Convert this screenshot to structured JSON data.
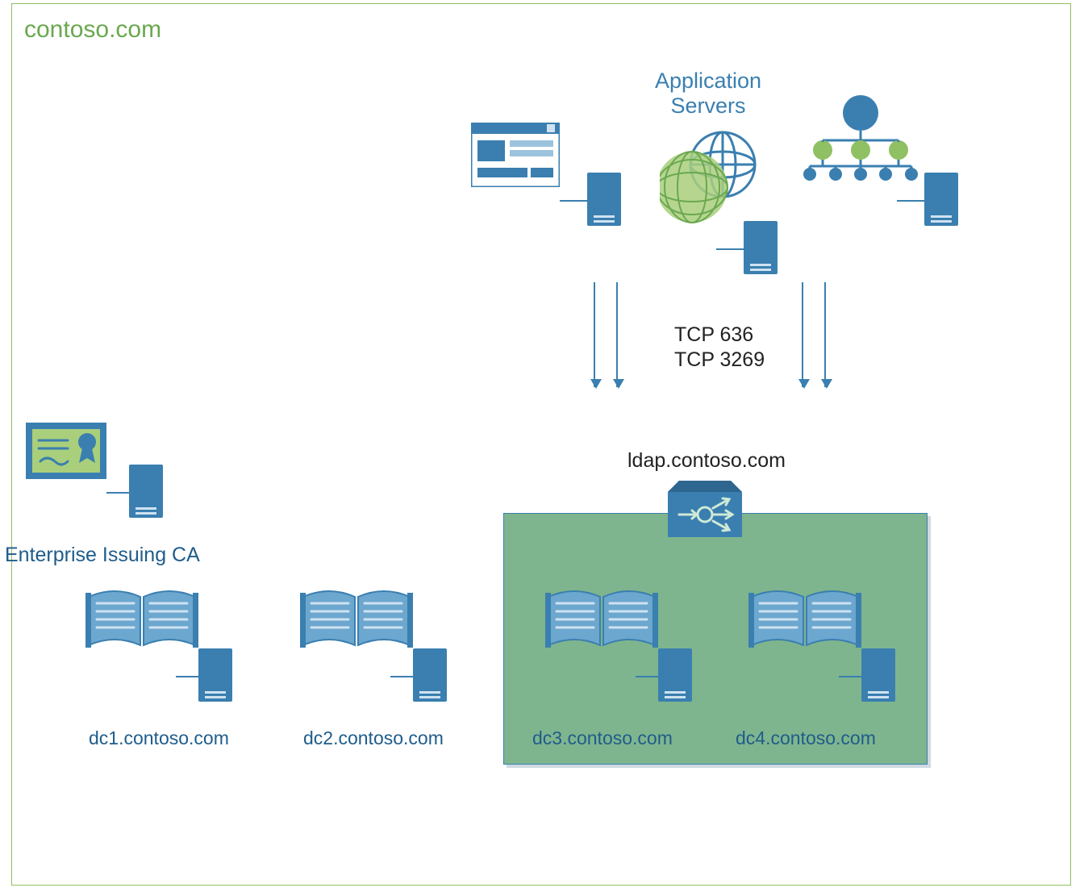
{
  "domainTitle": "contoso.com",
  "applicationServers": {
    "label": "Application\nServers"
  },
  "ports": {
    "line1": "TCP 636",
    "line2": "TCP 3269"
  },
  "ldap": {
    "hostname": "ldap.contoso.com"
  },
  "ca": {
    "label": "Enterprise Issuing CA"
  },
  "domainControllers": [
    {
      "name": "dc1.contoso.com"
    },
    {
      "name": "dc2.contoso.com"
    },
    {
      "name": "dc3.contoso.com"
    },
    {
      "name": "dc4.contoso.com"
    }
  ],
  "colors": {
    "accent": "#3a7fb0",
    "green": "#6aa84f",
    "pool": "#7fb58e"
  }
}
